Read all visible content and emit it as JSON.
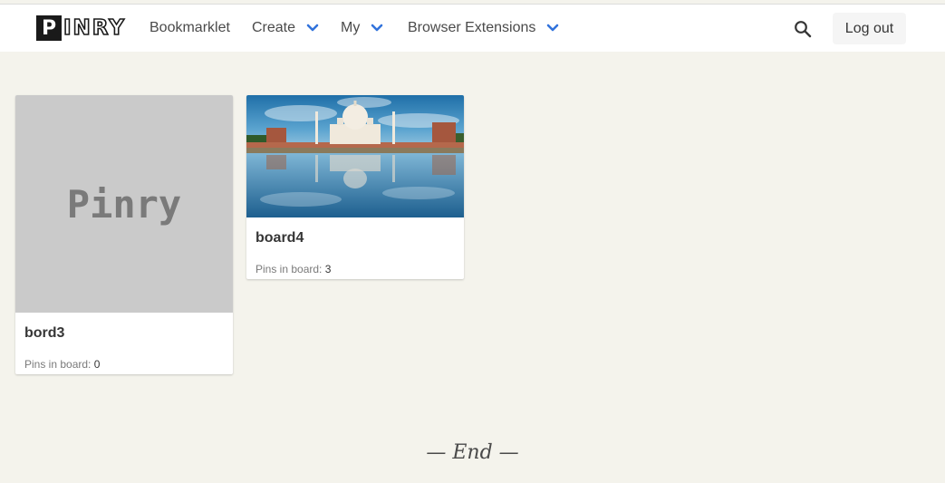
{
  "navbar": {
    "logo_text": "PINRY",
    "items": [
      {
        "label": "Bookmarklet",
        "has_dropdown": false
      },
      {
        "label": "Create",
        "has_dropdown": true
      },
      {
        "label": "My",
        "has_dropdown": true
      },
      {
        "label": "Browser Extensions",
        "has_dropdown": true
      }
    ],
    "search_icon": "search-icon",
    "logout_label": "Log out",
    "accent_color": "#3273dc"
  },
  "boards": [
    {
      "name": "bord3",
      "thumbnail": "placeholder",
      "placeholder_text": "Pinry",
      "pins_label": "Pins in board:",
      "pins_count": "0"
    },
    {
      "name": "board4",
      "thumbnail": "taj-mahal-photo",
      "pins_label": "Pins in board:",
      "pins_count": "3"
    }
  ],
  "footer": {
    "end_text": "— End —"
  }
}
